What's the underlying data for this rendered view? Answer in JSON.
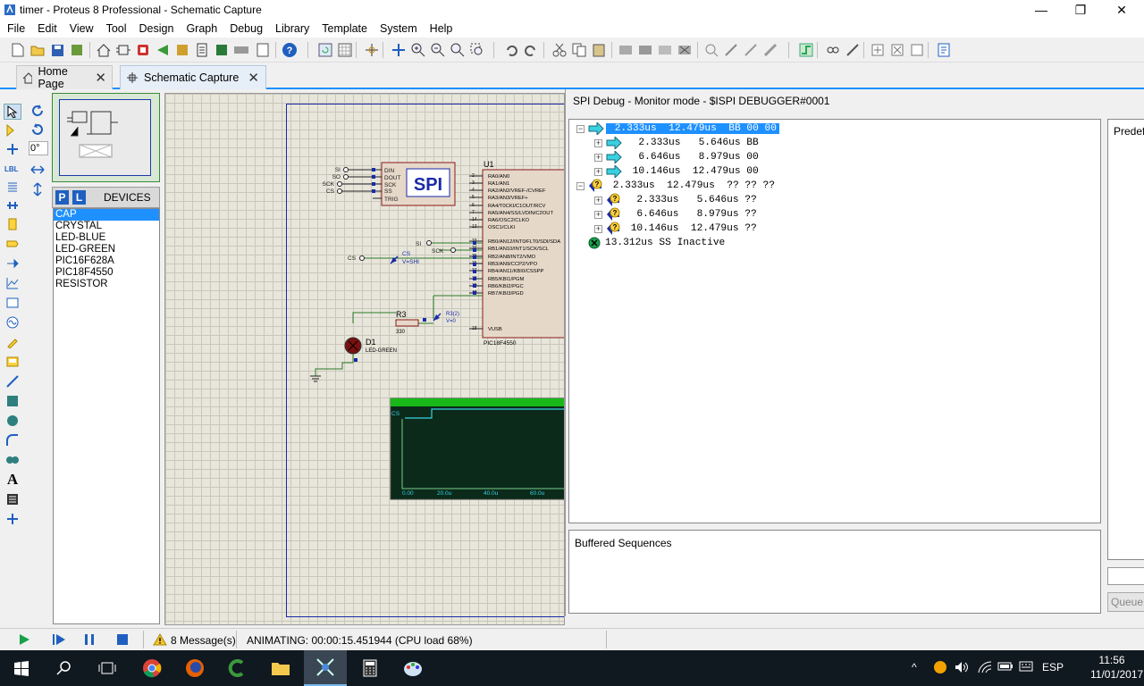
{
  "window": {
    "title": "timer - Proteus 8 Professional - Schematic Capture"
  },
  "menu": [
    "File",
    "Edit",
    "View",
    "Tool",
    "Design",
    "Graph",
    "Debug",
    "Library",
    "Template",
    "System",
    "Help"
  ],
  "tabs": [
    {
      "label": "Home Page",
      "icon": "home-icon"
    },
    {
      "label": "Schematic Capture",
      "icon": "schematic-icon"
    }
  ],
  "rotation": {
    "angle": "0°"
  },
  "devices": {
    "p_label": "P",
    "l_label": "L",
    "header": "DEVICES",
    "items": [
      "CAP",
      "CRYSTAL",
      "LED-BLUE",
      "LED-GREEN",
      "PIC16F628A",
      "PIC18F4550",
      "RESISTOR"
    ],
    "selected": "CAP"
  },
  "schematic": {
    "spi_block": {
      "title": "SPI",
      "pins_left": [
        "SI",
        "SO",
        "SCK",
        "CS"
      ],
      "pins_right": [
        "DIN",
        "DOUT",
        "SCK",
        "SS",
        "TRIG"
      ]
    },
    "mcu": {
      "ref": "U1",
      "part": "PIC18F4550",
      "pin_nums": [
        "2",
        "3",
        "4",
        "5",
        "6",
        "7",
        "14",
        "13",
        "33",
        "34",
        "35",
        "36",
        "37",
        "38",
        "39",
        "40",
        "18"
      ],
      "pins": [
        "RA0/AN0",
        "RA1/AN1",
        "RA2/AN2/VREF-/CVREF",
        "RA3/AN3/VREF+",
        "RA4/T0CKI/C1OUT/RCV",
        "RA5/AN4/SS/LVDIN/C2OUT",
        "RA6/OSC2/CLKO",
        "OSC1/CLKI",
        "RB0/AN12/INT0/FLT0/SDI/SDA",
        "RB1/AN10/INT1/SCK/SCL",
        "RB2/AN8/INT2/VMO",
        "RB3/AN9/CCP2/VPO",
        "RB4/AN11/KBI0/CSSPP",
        "RB5/KBI1/PGM",
        "RB6/KBI2/PGC",
        "RB7/KBI3/PGD",
        "VUSB"
      ]
    },
    "probes": [
      {
        "label": "CS",
        "value": "V=SHI"
      },
      {
        "label": "R3(2)",
        "value": "V=0"
      }
    ],
    "net_labels": {
      "si": "SI",
      "sck": "SCK",
      "cs": "CS"
    },
    "resistor": {
      "ref": "R3",
      "value": "330"
    },
    "led": {
      "ref": "D1",
      "part": "LED-GREEN"
    },
    "graph": {
      "trace": "CS",
      "x_ticks": [
        "0.00",
        "20.0u",
        "40.0u",
        "60.0u"
      ]
    }
  },
  "spi_debug": {
    "title": "SPI Debug - Monitor mode - $ISPI DEBUGGER#0001",
    "rows": [
      {
        "text": " 2.333us  12.479us  BB 00 00",
        "icon": "out-arrow",
        "level": 0,
        "expander": "−",
        "selected": true
      },
      {
        "text": "  2.333us   5.646us BB",
        "icon": "out-arrow",
        "level": 1,
        "expander": "+",
        "selected": false
      },
      {
        "text": "  6.646us   8.979us 00",
        "icon": "out-arrow",
        "level": 1,
        "expander": "+",
        "selected": false
      },
      {
        "text": " 10.146us  12.479us 00",
        "icon": "out-arrow",
        "level": 1,
        "expander": "+",
        "selected": false
      },
      {
        "text": " 2.333us  12.479us  ?? ?? ??",
        "icon": "in-query",
        "level": 0,
        "expander": "−",
        "selected": false
      },
      {
        "text": "  2.333us   5.646us ??",
        "icon": "in-query",
        "level": 1,
        "expander": "+",
        "selected": false
      },
      {
        "text": "  6.646us   8.979us ??",
        "icon": "in-query",
        "level": 1,
        "expander": "+",
        "selected": false
      },
      {
        "text": " 10.146us  12.479us ??",
        "icon": "in-query",
        "level": 1,
        "expander": "+",
        "selected": false
      },
      {
        "text": "13.312us SS Inactive",
        "icon": "ss-inactive",
        "level": 0,
        "expander": "",
        "selected": false
      }
    ],
    "buffered_label": "Buffered Sequences",
    "predef_label": "Predef",
    "queue_label": "Queue"
  },
  "status": {
    "messages": "8 Message(s)",
    "animating": "ANIMATING: 00:00:15.451944 (CPU load 68%)"
  },
  "taskbar": {
    "lang": "ESP",
    "time": "11:56",
    "date": "11/01/2017"
  },
  "colors": {
    "accent": "#1e90ff",
    "selection": "#1e90ff",
    "canvas": "#e8e6da",
    "graph_bg": "#0b2a1a",
    "graph_trace": "#39d0e0"
  }
}
